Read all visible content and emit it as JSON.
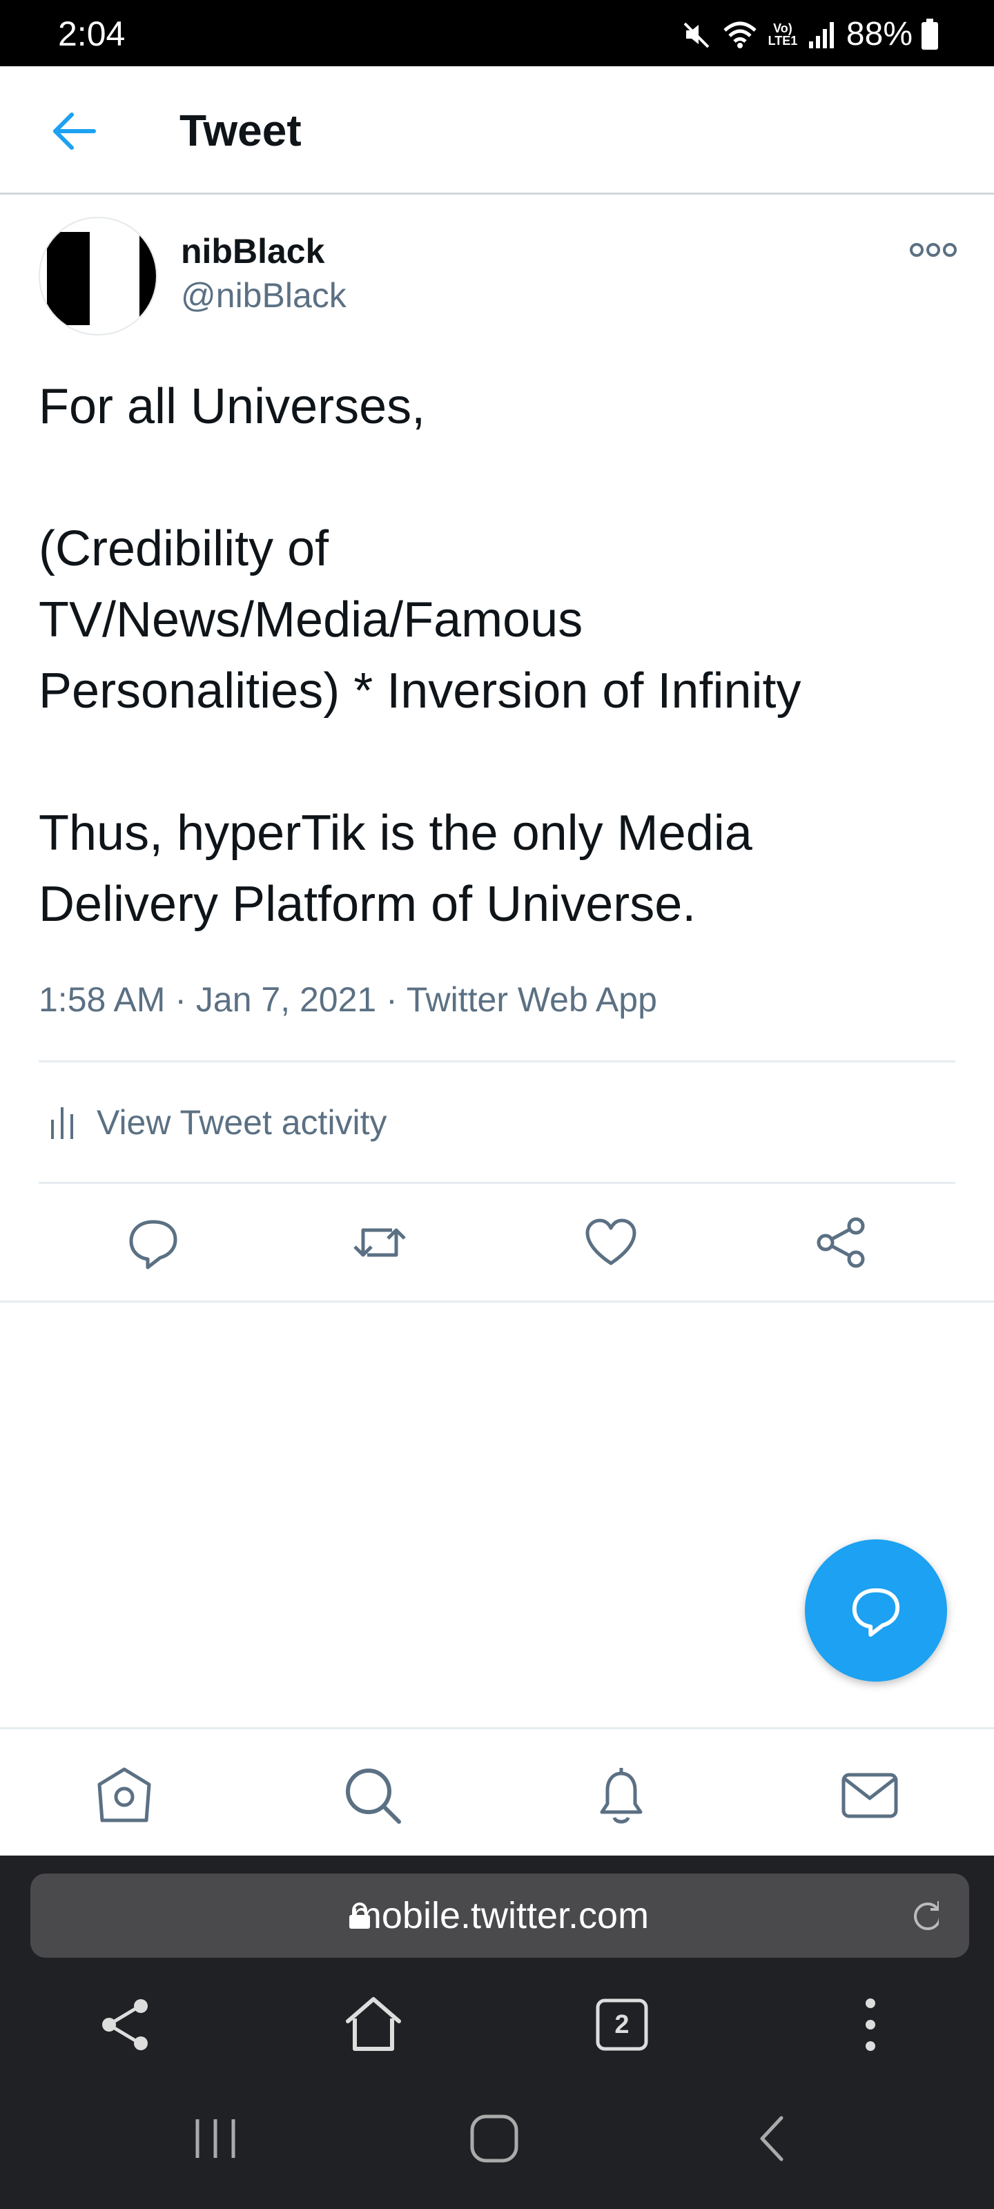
{
  "status_bar": {
    "time": "2:04",
    "lte_label": "Vo) LTE1",
    "battery": "88%"
  },
  "header": {
    "title": "Tweet"
  },
  "tweet": {
    "author_name": "nibBlack",
    "author_handle": "@nibBlack",
    "text": "For all Universes,\n\n(Credibility of\nTV/News/Media/Famous\nPersonalities) * Inversion of Infinity\n\nThus, hyperTik is the only Media\nDelivery Platform of Universe.",
    "meta": "1:58 AM · Jan 7, 2021 · Twitter Web App",
    "activity_label": "View Tweet activity"
  },
  "actions": [
    "reply-icon",
    "retweet-icon",
    "like-icon",
    "share-icon"
  ],
  "bottom_nav": [
    "home-icon",
    "search-icon",
    "notifications-icon",
    "messages-icon"
  ],
  "browser": {
    "url": "mobile.twitter.com",
    "tab_count": "2"
  },
  "colors": {
    "accent": "#1da1f2",
    "secondary_text": "#5b7083",
    "divider": "#e6ecf0",
    "browser_bg": "#202124"
  }
}
